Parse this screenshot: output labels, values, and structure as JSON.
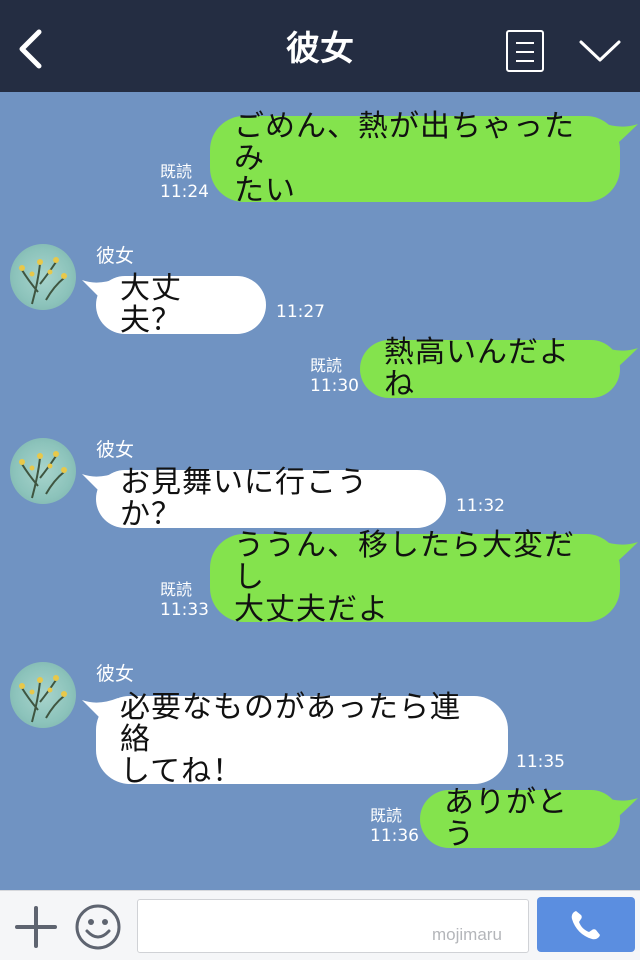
{
  "header": {
    "title": "彼女",
    "back_icon": "back-chevron-icon",
    "menu_icon": "menu-list-icon",
    "collapse_icon": "chevron-down-icon"
  },
  "messages": [
    {
      "from": "me",
      "lines": [
        "ごめん、熱が出ちゃったみ",
        "たい"
      ],
      "read": "既読",
      "time": "11:24"
    },
    {
      "from": "them",
      "sender": "彼女",
      "lines": [
        "大丈夫？"
      ],
      "time": "11:27"
    },
    {
      "from": "me",
      "lines": [
        "熱高いんだよね"
      ],
      "read": "既読",
      "time": "11:30"
    },
    {
      "from": "them",
      "sender": "彼女",
      "lines": [
        "お見舞いに行こうか？"
      ],
      "time": "11:32"
    },
    {
      "from": "me",
      "lines": [
        "ううん、移したら大変だし",
        "大丈夫だよ"
      ],
      "read": "既読",
      "time": "11:33"
    },
    {
      "from": "them",
      "sender": "彼女",
      "lines": [
        "必要なものがあったら連絡",
        "してね！"
      ],
      "time": "11:35"
    },
    {
      "from": "me",
      "lines": [
        "ありがとう"
      ],
      "read": "既読",
      "time": "11:36"
    }
  ],
  "input": {
    "placeholder": "",
    "watermark": "mojimaru"
  },
  "colors": {
    "header_bg": "#242d42",
    "chat_bg": "#7093c2",
    "my_bubble": "#84e34d",
    "their_bubble": "#ffffff",
    "call_button": "#5b8ee0"
  }
}
